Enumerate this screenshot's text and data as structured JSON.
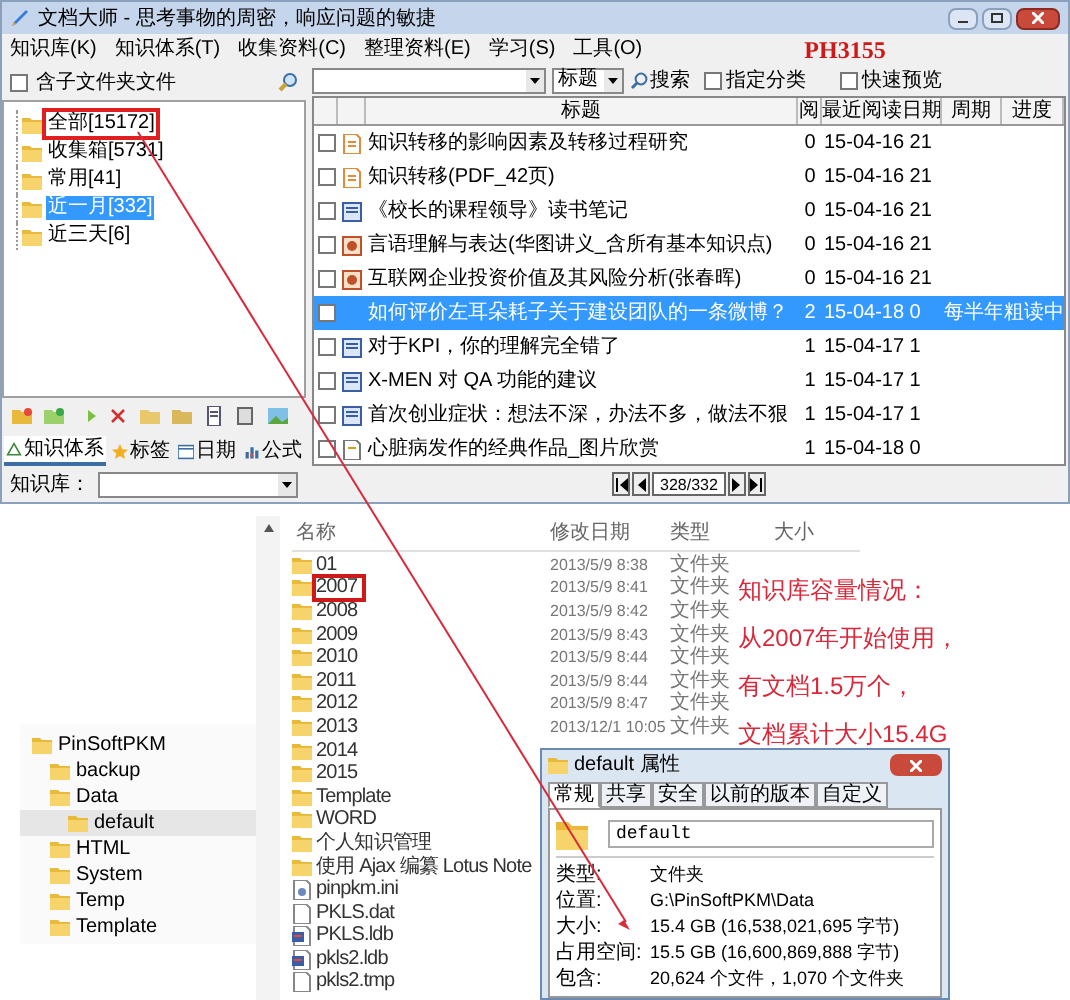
{
  "main_window": {
    "title": "文档大师 - 思考事物的周密，响应问题的敏捷",
    "menu": [
      "知识库(K)",
      "知识体系(T)",
      "收集资料(C)",
      "整理资料(E)",
      "学习(S)",
      "工具(O)"
    ],
    "tag": "PH3155",
    "include_subfolders": {
      "label": "含子文件夹文件",
      "checked": false
    },
    "tree": [
      {
        "label": "全部[15172]",
        "selected": false,
        "highlighted": true
      },
      {
        "label": "收集箱[5731]",
        "selected": false,
        "highlighted": false
      },
      {
        "label": "常用[41]",
        "selected": false,
        "highlighted": false
      },
      {
        "label": "近一月[332]",
        "selected": true,
        "highlighted": false
      },
      {
        "label": "近三天[6]",
        "selected": false,
        "highlighted": false
      }
    ],
    "tabs": [
      {
        "kind": "tree",
        "label": "知识体系",
        "selected": true
      },
      {
        "kind": "star",
        "label": "标签",
        "selected": false
      },
      {
        "kind": "calendar",
        "label": "日期",
        "selected": false
      },
      {
        "kind": "chart",
        "label": "公式",
        "selected": false
      }
    ],
    "library_label": "知识库：",
    "search": {
      "field_option": "标题",
      "button": "搜索",
      "options": [
        {
          "label": "指定分类",
          "checked": false
        },
        {
          "label": "快速预览",
          "checked": false
        }
      ]
    },
    "table": {
      "columns": [
        "标题",
        "阅",
        "最近阅读日期",
        "周期",
        "进度"
      ],
      "rows": [
        {
          "kind": "pdf",
          "title": "知识转移的影响因素及转移过程研究",
          "reads": "0",
          "date": "15-04-16 21",
          "checked": false,
          "selected": false
        },
        {
          "kind": "pdf",
          "title": "知识转移(PDF_42页)",
          "reads": "0",
          "date": "15-04-16 21",
          "checked": false,
          "selected": false
        },
        {
          "kind": "note",
          "title": "《校长的课程领导》读书笔记",
          "reads": "0",
          "date": "15-04-16 21",
          "checked": false,
          "selected": false
        },
        {
          "kind": "web",
          "title": "言语理解与表达(华图讲义_含所有基本知识点)",
          "reads": "0",
          "date": "15-04-16 21",
          "checked": false,
          "selected": false
        },
        {
          "kind": "web",
          "title": "互联网企业投资价值及其风险分析(张春晖)",
          "reads": "0",
          "date": "15-04-16 21",
          "checked": false,
          "selected": false
        },
        {
          "kind": "none",
          "title": "如何评价左耳朵耗子关于建设团队的一条微博？",
          "reads": "2",
          "date": "15-04-18 0",
          "cycle": "每半年",
          "progress": "粗读中",
          "checked": false,
          "selected": true
        },
        {
          "kind": "note",
          "title": "对于KPI，你的理解完全错了",
          "reads": "1",
          "date": "15-04-17 1",
          "checked": false,
          "selected": false
        },
        {
          "kind": "note",
          "title": "X-MEN 对 QA 功能的建议",
          "reads": "1",
          "date": "15-04-17 1",
          "checked": false,
          "selected": false
        },
        {
          "kind": "note",
          "title": "首次创业症状：想法不深，办法不多，做法不狠",
          "reads": "1",
          "date": "15-04-17 1",
          "checked": false,
          "selected": false
        },
        {
          "kind": "text",
          "title": "心脏病发作的经典作品_图片欣赏",
          "reads": "1",
          "date": "15-04-18 0",
          "checked": false,
          "selected": false
        }
      ]
    },
    "pager": "328/332"
  },
  "folder_tree": [
    {
      "label": "PinSoftPKM",
      "selected": false,
      "children": [
        {
          "label": "backup",
          "selected": false
        },
        {
          "label": "Data",
          "selected": false,
          "children": [
            {
              "label": "default",
              "selected": true
            }
          ]
        },
        {
          "label": "HTML",
          "selected": false
        },
        {
          "label": "System",
          "selected": false
        },
        {
          "label": "Temp",
          "selected": false
        },
        {
          "label": "Template",
          "selected": false
        }
      ]
    }
  ],
  "file_list": {
    "columns": [
      "名称",
      "修改日期",
      "类型",
      "大小"
    ],
    "rows": [
      {
        "kind": "folder",
        "name": "01",
        "date": "2013/5/9 8:38",
        "type": "文件夹",
        "highlighted": false
      },
      {
        "kind": "folder",
        "name": "2007",
        "date": "2013/5/9 8:41",
        "type": "文件夹",
        "highlighted": true
      },
      {
        "kind": "folder",
        "name": "2008",
        "date": "2013/5/9 8:42",
        "type": "文件夹",
        "highlighted": false
      },
      {
        "kind": "folder",
        "name": "2009",
        "date": "2013/5/9 8:43",
        "type": "文件夹",
        "highlighted": false
      },
      {
        "kind": "folder",
        "name": "2010",
        "date": "2013/5/9 8:44",
        "type": "文件夹",
        "highlighted": false
      },
      {
        "kind": "folder",
        "name": "2011",
        "date": "2013/5/9 8:44",
        "type": "文件夹",
        "highlighted": false
      },
      {
        "kind": "folder",
        "name": "2012",
        "date": "2013/5/9 8:47",
        "type": "文件夹",
        "highlighted": false
      },
      {
        "kind": "folder",
        "name": "2013",
        "date": "2013/12/1 10:05",
        "type": "文件夹",
        "highlighted": false
      },
      {
        "kind": "folder",
        "name": "2014",
        "highlighted": false
      },
      {
        "kind": "folder",
        "name": "2015",
        "highlighted": false
      },
      {
        "kind": "folder",
        "name": "Template",
        "highlighted": false
      },
      {
        "kind": "folder",
        "name": "WORD",
        "highlighted": false
      },
      {
        "kind": "folder",
        "name": "个人知识管理",
        "highlighted": false
      },
      {
        "kind": "folder",
        "name": "使用 Ajax 编纂 Lotus Note",
        "highlighted": false
      },
      {
        "kind": "settings",
        "name": "pinpkm.ini",
        "highlighted": false
      },
      {
        "kind": "file",
        "name": "PKLS.dat",
        "highlighted": false
      },
      {
        "kind": "database",
        "name": "PKLS.ldb",
        "highlighted": false
      },
      {
        "kind": "database",
        "name": "pkls2.ldb",
        "highlighted": false
      },
      {
        "kind": "file",
        "name": "pkls2.tmp",
        "highlighted": false
      }
    ]
  },
  "properties_dialog": {
    "title": "default 属性",
    "tabs": [
      {
        "label": "常规",
        "selected": true
      },
      {
        "label": "共享",
        "selected": false
      },
      {
        "label": "安全",
        "selected": false
      },
      {
        "label": "以前的版本",
        "selected": false
      },
      {
        "label": "自定义",
        "selected": false
      }
    ],
    "name": "default",
    "fields": [
      {
        "label": "类型:",
        "value": "文件夹"
      },
      {
        "label": "位置:",
        "value": "G:\\PinSoftPKM\\Data"
      },
      {
        "label": "大小:",
        "value": "15.4 GB (16,538,021,695 字节)"
      },
      {
        "label": "占用空间:",
        "value": "15.5 GB (16,600,869,888 字节)"
      },
      {
        "label": "包含:",
        "value": "20,624 个文件，1,070 个文件夹"
      }
    ]
  },
  "annotation": {
    "lines": [
      "知识库容量情况：",
      "从2007年开始使用，",
      "有文档1.5万个，",
      "文档累计大小15.4G"
    ]
  }
}
